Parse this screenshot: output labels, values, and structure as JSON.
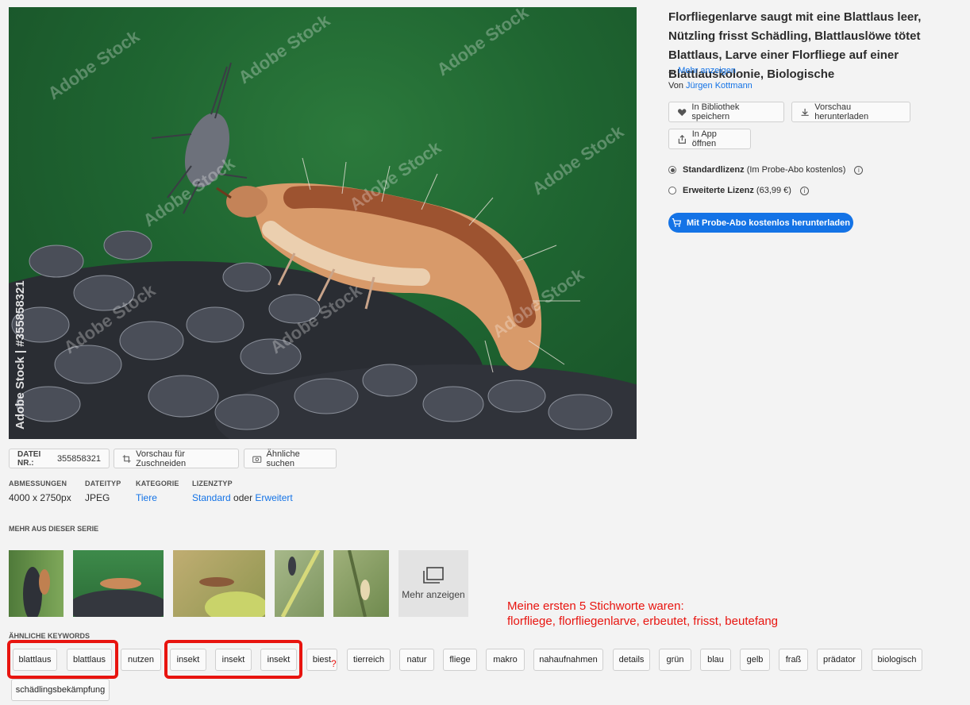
{
  "image": {
    "watermark": "Adobe Stock",
    "side_watermark": "Adobe Stock | #355858321"
  },
  "asset": {
    "title": "Florfliegenlarve saugt mit eine Blattlaus leer, Nützling frisst Schädling, Blattlauslöwe tötet Blattlaus, Larve einer Florfliege auf einer Blattlauskolonie, Biologische",
    "ellipsis": "...",
    "more_link": "Mehr anzeigen",
    "author_prefix": "Von",
    "author": "Jürgen Kottmann"
  },
  "actions": {
    "save_library": "In Bibliothek speichern",
    "download_preview": "Vorschau herunterladen",
    "open_in_app": "In App öffnen"
  },
  "license": {
    "standard_label": "Standardlizenz",
    "standard_note": "(Im Probe-Abo kostenlos)",
    "extended_label": "Erweiterte Lizenz",
    "extended_note": "(63,99 €)",
    "selected": "standard",
    "cta": "Mit Probe-Abo kostenlos herunterladen"
  },
  "file_bar": {
    "file_nr_label": "DATEI NR.:",
    "file_nr": "355858321",
    "crop_preview": "Vorschau für Zuschneiden",
    "find_similar": "Ähnliche suchen"
  },
  "meta": {
    "dimensions_label": "ABMESSUNGEN",
    "dimensions": "4000 x 2750px",
    "filetype_label": "DATEITYP",
    "filetype": "JPEG",
    "category_label": "KATEGORIE",
    "category": "Tiere",
    "licensetype_label": "LIZENZTYP",
    "license_standard": "Standard",
    "license_or": "oder",
    "license_extended": "Erweitert"
  },
  "series": {
    "heading": "MEHR AUS DIESER SERIE",
    "more": "Mehr anzeigen"
  },
  "keywords": {
    "heading": "ÄHNLICHE KEYWORDS",
    "items": [
      "blattlaus",
      "blattlaus",
      "nutzen",
      "insekt",
      "insekt",
      "insekt",
      "biest",
      "tierreich",
      "natur",
      "fliege",
      "makro",
      "nahaufnahmen",
      "details",
      "grün",
      "blau",
      "gelb",
      "fraß",
      "prädator",
      "biologisch",
      "schädlingsbekämpfung"
    ]
  },
  "annotation": {
    "line1": "Meine ersten 5 Stichworte waren:",
    "line2": "florfliege, florfliegenlarve, erbeutet, frisst, beutefang",
    "question": "?"
  },
  "colors": {
    "accent": "#1473e6",
    "annotation_red": "#e8140f"
  }
}
